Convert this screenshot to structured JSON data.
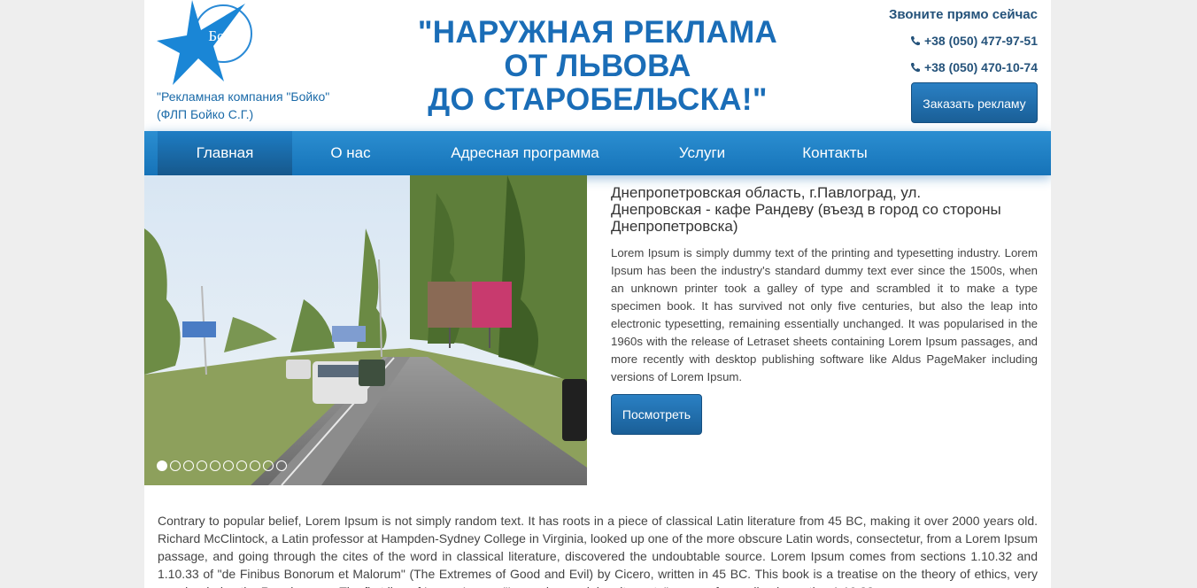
{
  "header": {
    "logo_text": "Бойко",
    "company_line1": "\"Рекламная компания \"Бойко\"",
    "company_line2": "(ФЛП Бойко С.Г.)",
    "headline_line1": "\"НАРУЖНАЯ РЕКЛАМА",
    "headline_line2": "ОТ ЛЬВОВА",
    "headline_line3": "ДО СТАРОБЕЛЬСКА!\"",
    "call_now": "Звоните прямо сейчас",
    "phones": [
      "+38 (050) 477-97-51",
      "+38 (050) 470-10-74"
    ],
    "order_button": "Заказать рекламу"
  },
  "nav": {
    "items": [
      "Главная",
      "О нас",
      "Адресная программа",
      "Услуги",
      "Контакты"
    ],
    "active": "Главная"
  },
  "slider": {
    "slide_count": 10,
    "active_slide": 1,
    "title_line1": "Днепропетровская область, г.Павлоград, ул.",
    "title_line2": "Днепровская - кафе Рандеву (въезд в город со стороны",
    "title_line3": "Днепропетровска)",
    "description": "Lorem Ipsum is simply dummy text of the printing and typesetting industry. Lorem Ipsum has been the industry's standard dummy text ever since the 1500s, when an unknown printer took a galley of type and scrambled it to make a type specimen book. It has survived not only five centuries, but also the leap into electronic typesetting, remaining essentially unchanged. It was popularised in the 1960s with the release of Letraset sheets containing Lorem Ipsum passages, and more recently with desktop publishing software like Aldus PageMaker including versions of Lorem Ipsum.",
    "view_button": "Посмотреть"
  },
  "body_text": "Contrary to popular belief, Lorem Ipsum is not simply random text. It has roots in a piece of classical Latin literature from 45 BC, making it over 2000 years old. Richard McClintock, a Latin professor at Hampden-Sydney College in Virginia, looked up one of the more obscure Latin words, consectetur, from a Lorem Ipsum passage, and going through the cites of the word in classical literature, discovered the undoubtable source. Lorem Ipsum comes from sections 1.10.32 and 1.10.33 of \"de Finibus Bonorum et Malorum\" (The Extremes of Good and Evil) by Cicero, written in 45 BC. This book is a treatise on the theory of ethics, very popular during the Renaissance. The first line of Lorem Ipsum, \"Lorem ipsum dolor sit amet..\", comes from a line in section 1.10.32.",
  "colors": {
    "brand_blue": "#1a6db7",
    "nav_blue": "#1673b8",
    "dark_text": "#24527a"
  },
  "icons": {
    "phone": "phone-icon",
    "logo": "star-logo-icon"
  }
}
